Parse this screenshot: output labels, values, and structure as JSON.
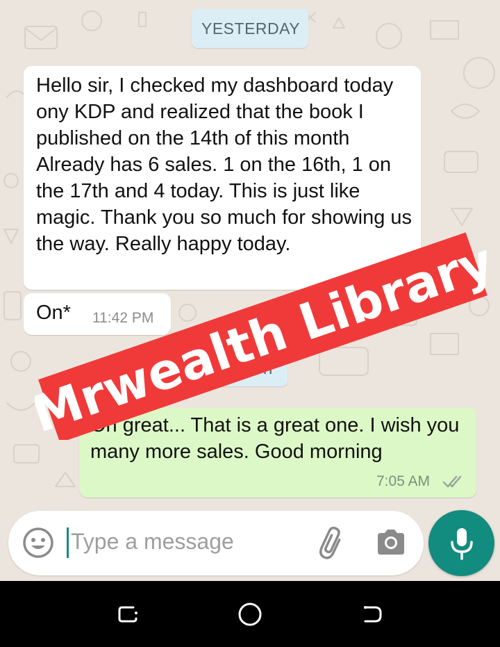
{
  "chat": {
    "date_chip_1": "YESTERDAY",
    "date_chip_2": "TODAY",
    "messages": [
      {
        "direction": "incoming",
        "text": "Hello sir, I checked my dashboard today ony KDP and realized that the book I published on the 14th of this month Already has 6 sales. 1 on the 16th, 1 on the 17th and 4 today. This is just like magic. Thank you so much for showing us the way. Really happy today."
      },
      {
        "direction": "incoming",
        "text": "On*",
        "time": "11:42 PM"
      },
      {
        "direction": "outgoing",
        "text": "Oh great... That is a great one. I wish you many more sales. Good morning",
        "time": "7:05 AM",
        "status": "read-ticks-icon"
      }
    ]
  },
  "watermark": {
    "text": "Mrwealth Library",
    "color": "#f03a3a"
  },
  "input": {
    "placeholder": "Type a message",
    "emoji_icon": "emoji-icon",
    "attach_icon": "paperclip-icon",
    "camera_icon": "camera-icon"
  },
  "mic_button": {
    "icon": "microphone-icon",
    "color": "#128c7e"
  },
  "nav_bar": {
    "recents_icon": "recents-icon",
    "home_icon": "home-icon",
    "back_icon": "back-icon"
  }
}
